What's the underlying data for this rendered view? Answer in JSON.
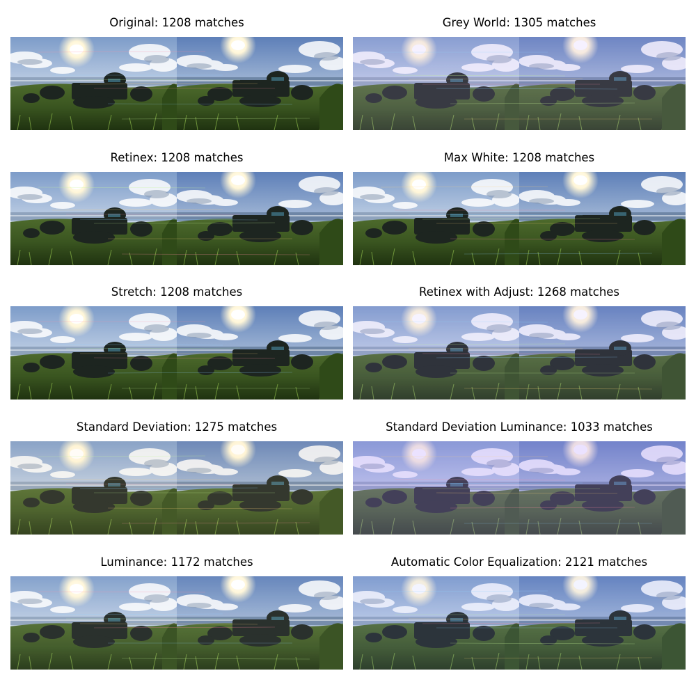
{
  "figure": {
    "panels": [
      {
        "title": "Original: 1208 matches",
        "tint": "#000000",
        "tint_opacity": 0.0
      },
      {
        "title": "Grey World: 1305 matches",
        "tint": "#c8a8ff",
        "tint_opacity": 0.16
      },
      {
        "title": "Retinex: 1208 matches",
        "tint": "#000000",
        "tint_opacity": 0.0
      },
      {
        "title": "Max White: 1208 matches",
        "tint": "#000000",
        "tint_opacity": 0.0
      },
      {
        "title": "Stretch: 1208 matches",
        "tint": "#000000",
        "tint_opacity": 0.0
      },
      {
        "title": "Retinex with Adjust: 1268 matches",
        "tint": "#b89cff",
        "tint_opacity": 0.12
      },
      {
        "title": "Standard Deviation: 1275 matches",
        "tint": "#ffe6b0",
        "tint_opacity": 0.1
      },
      {
        "title": "Standard Deviation Luminance: 1033 matches",
        "tint": "#b090ff",
        "tint_opacity": 0.26
      },
      {
        "title": "Luminance: 1172 matches",
        "tint": "#ffffff",
        "tint_opacity": 0.06
      },
      {
        "title": "Automatic Color Equalization: 2121 matches",
        "tint": "#9aa6ff",
        "tint_opacity": 0.12
      }
    ]
  }
}
